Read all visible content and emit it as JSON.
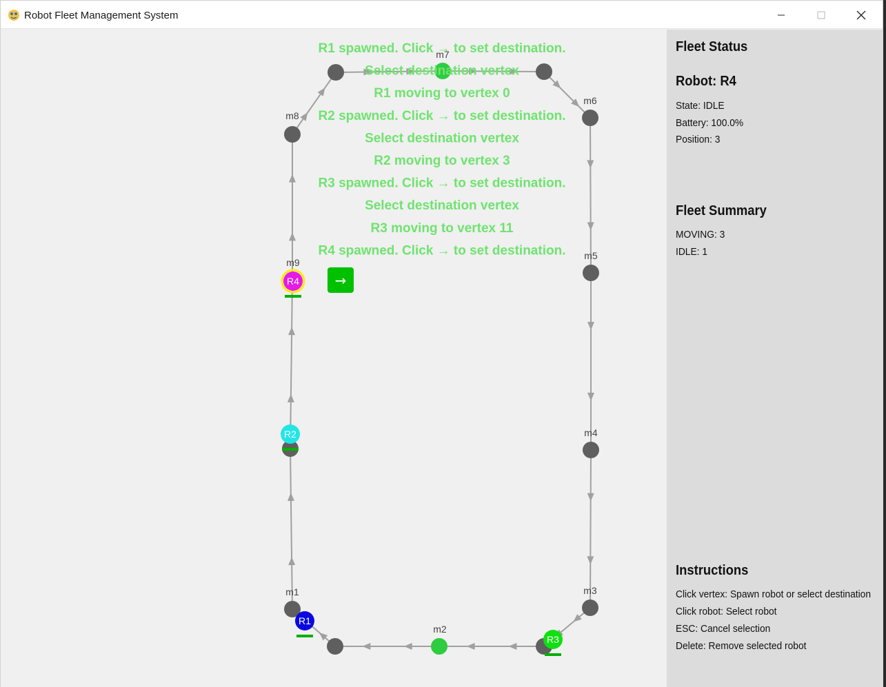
{
  "window": {
    "title": "Robot Fleet Management System",
    "minimize_icon": "minimize-icon",
    "maximize_icon": "maximize-icon",
    "close_icon": "close-icon"
  },
  "colors": {
    "vertex": "#5f5f5f",
    "vertex_active": "#2ecc40",
    "edge": "#a0a0a0",
    "log_text": "#6fe36f",
    "confirm_button": "#00c000",
    "battery_bar": "#00b000",
    "selected_ring": "#ffeb00"
  },
  "graph": {
    "vertex_labels": {
      "m1": "m1",
      "m2": "m2",
      "m3": "m3",
      "m4": "m4",
      "m5": "m5",
      "m6": "m6",
      "m7": "m7",
      "m8": "m8",
      "m9": "m9"
    }
  },
  "robots": {
    "R1": {
      "label": "R1",
      "color": "#0a0ae0"
    },
    "R2": {
      "label": "R2",
      "color": "#22e6e6"
    },
    "R3": {
      "label": "R3",
      "color": "#10e010"
    },
    "R4": {
      "label": "R4",
      "color": "#e619e6"
    }
  },
  "log": [
    "R1 spawned. Click → to set destination.",
    "Select destination vertex",
    "R1 moving to vertex 0",
    "R2 spawned. Click → to set destination.",
    "Select destination vertex",
    "R2 moving to vertex 3",
    "R3 spawned. Click → to set destination.",
    "Select destination vertex",
    "R3 moving to vertex 11",
    "R4 spawned. Click → to set destination."
  ],
  "confirm_button": {
    "label": "→"
  },
  "panel": {
    "fleet_status_title": "Fleet Status",
    "robot_title": "Robot: R4",
    "state": "State: IDLE",
    "battery": "Battery: 100.0%",
    "position": "Position: 3",
    "summary_title": "Fleet Summary",
    "summary_moving": "MOVING: 3",
    "summary_idle": "IDLE: 1",
    "instructions_title": "Instructions",
    "instructions": [
      "Click vertex: Spawn robot or select destination",
      "Click robot: Select robot",
      "ESC: Cancel selection",
      "Delete: Remove selected robot"
    ]
  }
}
